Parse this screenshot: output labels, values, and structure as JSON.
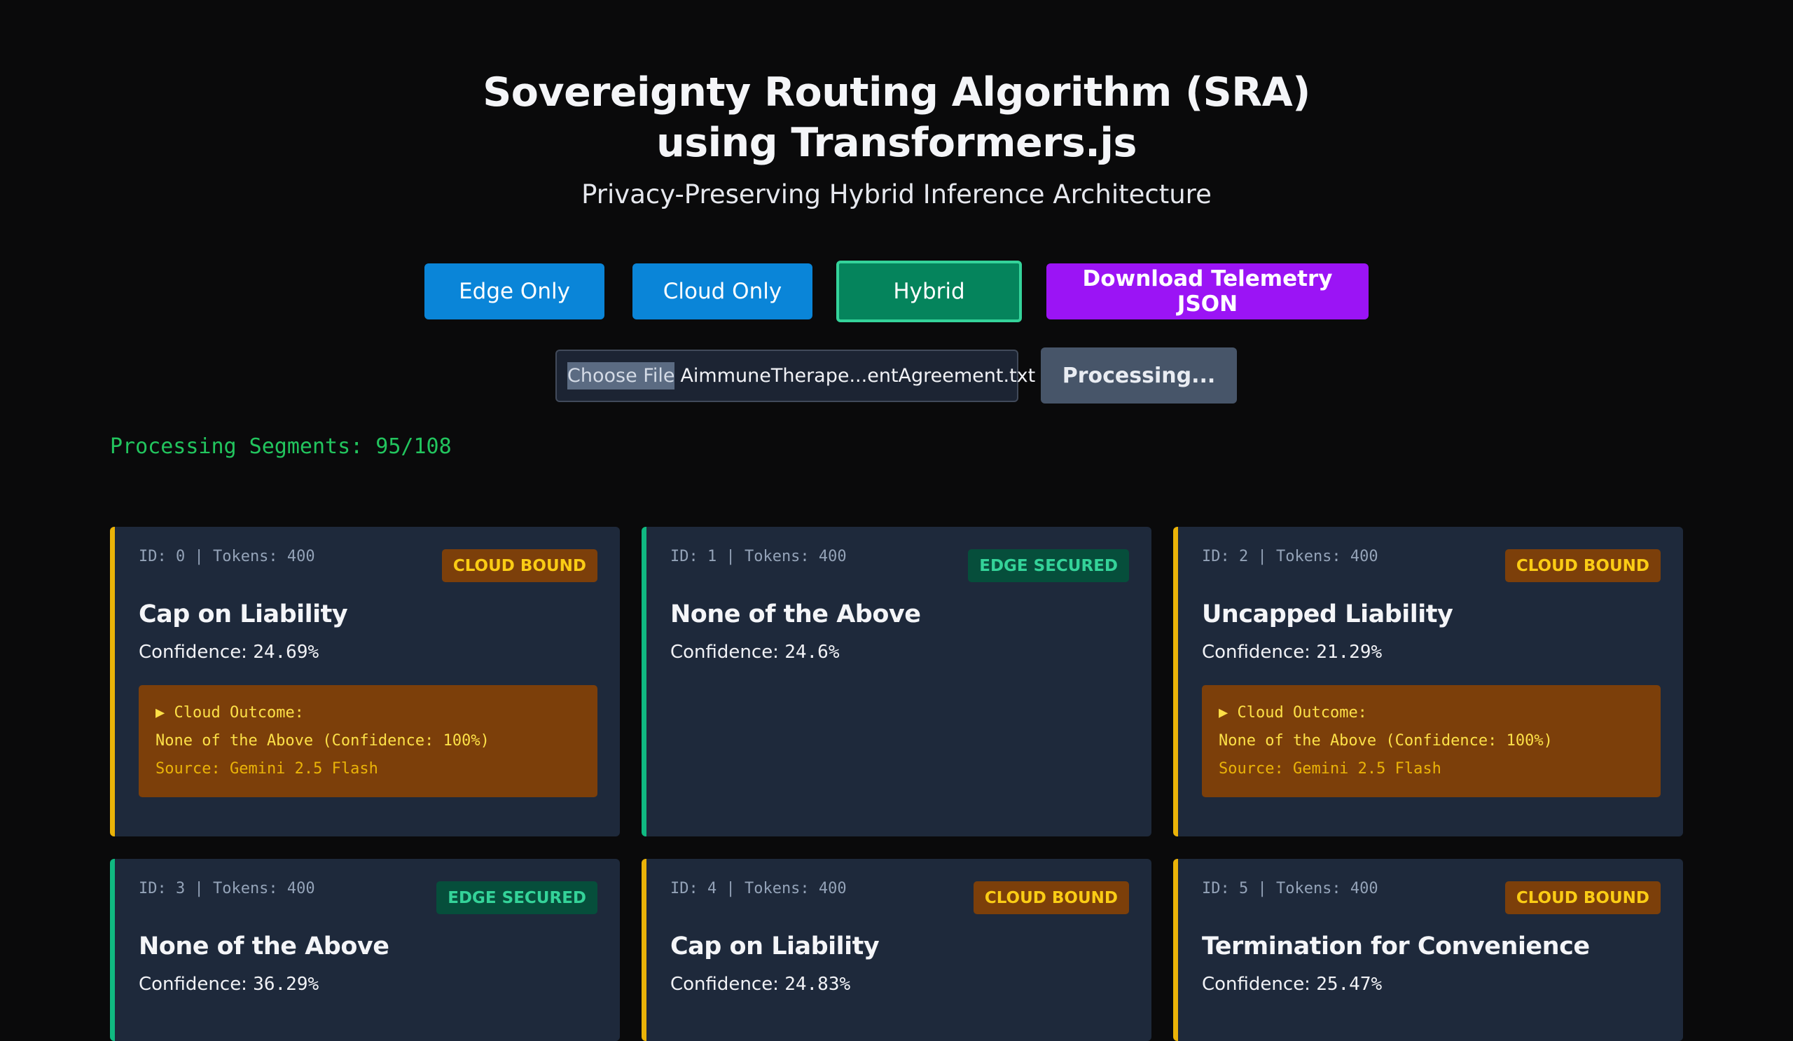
{
  "header": {
    "title_line1": "Sovereignty Routing Algorithm (SRA)",
    "title_line2": "using Transformers.js",
    "subtitle": "Privacy-Preserving Hybrid Inference Architecture"
  },
  "modes": {
    "edge_only": "Edge Only",
    "cloud_only": "Cloud Only",
    "hybrid": "Hybrid",
    "selected": "Hybrid"
  },
  "download_label": "Download Telemetry JSON",
  "file_input": {
    "choose_label": "Choose File",
    "file_name": "AimmuneTherape...entAgreement.txt"
  },
  "process_button": "Processing...",
  "progress": {
    "text": "Processing Segments: 95/108",
    "processed": 95,
    "total": 108
  },
  "cards": [
    {
      "meta": "ID: 0 | Tokens: 400",
      "badge": "CLOUD BOUND",
      "title": "Cap on Liability",
      "confidence_label": "Confidence: ",
      "confidence_value": "24.69%",
      "outcome": {
        "heading": "Cloud Outcome:",
        "result": "None of the Above (Confidence: 100%)",
        "source": "Source: Gemini 2.5 Flash"
      }
    },
    {
      "meta": "ID: 1 | Tokens: 400",
      "badge": "EDGE SECURED",
      "title": "None of the Above",
      "confidence_label": "Confidence: ",
      "confidence_value": "24.6%"
    },
    {
      "meta": "ID: 2 | Tokens: 400",
      "badge": "CLOUD BOUND",
      "title": "Uncapped Liability",
      "confidence_label": "Confidence: ",
      "confidence_value": "21.29%",
      "outcome": {
        "heading": "Cloud Outcome:",
        "result": "None of the Above (Confidence: 100%)",
        "source": "Source: Gemini 2.5 Flash"
      }
    },
    {
      "meta": "ID: 3 | Tokens: 400",
      "badge": "EDGE SECURED",
      "title": "None of the Above",
      "confidence_label": "Confidence: ",
      "confidence_value": "36.29%"
    },
    {
      "meta": "ID: 4 | Tokens: 400",
      "badge": "CLOUD BOUND",
      "title": "Cap on Liability",
      "confidence_label": "Confidence: ",
      "confidence_value": "24.83%"
    },
    {
      "meta": "ID: 5 | Tokens: 400",
      "badge": "CLOUD BOUND",
      "title": "Termination for Convenience",
      "confidence_label": "Confidence: ",
      "confidence_value": "25.47%"
    }
  ],
  "colors": {
    "background": "#0a0a0b",
    "card_background": "#1e293b",
    "cloud_accent": "#eab308",
    "edge_accent": "#10b981",
    "primary_button": "#0a85d8",
    "hybrid_button": "#05845c",
    "download_button": "#9b14f5",
    "progress_text": "#22c55e"
  }
}
